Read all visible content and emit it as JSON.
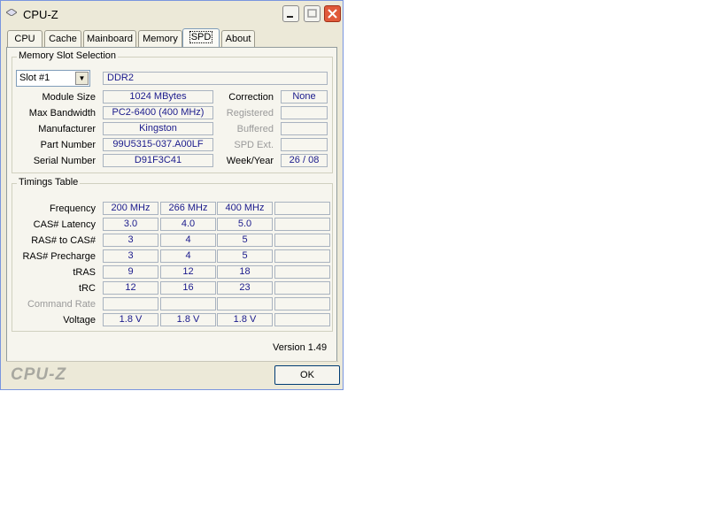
{
  "window": {
    "title": "CPU-Z"
  },
  "tabs": [
    {
      "label": "CPU"
    },
    {
      "label": "Cache"
    },
    {
      "label": "Mainboard"
    },
    {
      "label": "Memory"
    },
    {
      "label": "SPD"
    },
    {
      "label": "About"
    }
  ],
  "slot": {
    "group_title": "Memory Slot Selection",
    "selected": "Slot #1",
    "type": "DDR2",
    "rows": [
      {
        "label": "Module Size",
        "value": "1024 MBytes",
        "rlabel": "Correction",
        "rvalue": "None"
      },
      {
        "label": "Max Bandwidth",
        "value": "PC2-6400 (400 MHz)",
        "rlabel": "Registered",
        "rvalue": ""
      },
      {
        "label": "Manufacturer",
        "value": "Kingston",
        "rlabel": "Buffered",
        "rvalue": ""
      },
      {
        "label": "Part Number",
        "value": "99U5315-037.A00LF",
        "rlabel": "SPD Ext.",
        "rvalue": ""
      },
      {
        "label": "Serial Number",
        "value": "D91F3C41",
        "rlabel": "Week/Year",
        "rvalue": "26 / 08"
      }
    ]
  },
  "timings": {
    "group_title": "Timings Table",
    "rows": [
      {
        "label": "Frequency",
        "values": [
          "200 MHz",
          "266 MHz",
          "400 MHz",
          ""
        ]
      },
      {
        "label": "CAS# Latency",
        "values": [
          "3.0",
          "4.0",
          "5.0",
          ""
        ]
      },
      {
        "label": "RAS# to CAS#",
        "values": [
          "3",
          "4",
          "5",
          ""
        ]
      },
      {
        "label": "RAS# Precharge",
        "values": [
          "3",
          "4",
          "5",
          ""
        ]
      },
      {
        "label": "tRAS",
        "values": [
          "9",
          "12",
          "18",
          ""
        ]
      },
      {
        "label": "tRC",
        "values": [
          "12",
          "16",
          "23",
          ""
        ]
      },
      {
        "label": "Command Rate",
        "values": [
          "",
          "",
          "",
          ""
        ]
      },
      {
        "label": "Voltage",
        "values": [
          "1.8 V",
          "1.8 V",
          "1.8 V",
          ""
        ]
      }
    ]
  },
  "version": "Version 1.49",
  "footer": {
    "logo": "CPU-Z",
    "ok_label": "OK"
  },
  "colors": {
    "value_text": "#1a1a8c",
    "panel_bg": "#f6f5ee",
    "window_bg": "#ece9d8"
  },
  "icons": {
    "app": "cpu-z-diamond-icon",
    "minimize": "minimize-icon",
    "maximize": "maximize-icon",
    "close": "close-icon"
  }
}
